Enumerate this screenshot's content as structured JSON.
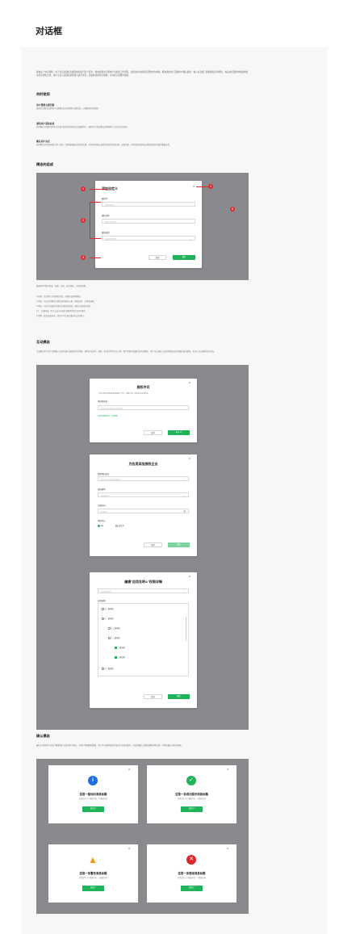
{
  "page": {
    "title": "对话框"
  },
  "intro": "模态是一种对话框，用于显示关键信息或请求您执行某个任务。模态会通过打断用户当前的工作流程，迫使用户先处理对话框中的内容。模态通常用于需要用户确认操作、输入信息或了解重要提示的场景，在完成对话框内的操作或关闭对话框之前，用户无法与页面的其他部分进行交互。因此在使用时应谨慎，只在真正需要时使用。",
  "when": {
    "heading": "何时使用",
    "items": [
      {
        "title": "用户需要立即回复",
        "desc": "使用对话框来请求用户立即做出决定或提供关键信息，以便继续当前流程。"
      },
      {
        "title": "通知用户紧急信息",
        "desc": "使用模式对话框可将有关系统当前状态的紧急信息通知用户，通常用于系统错误或需要用户立刻关注的情况。"
      },
      {
        "title": "确认用户决定",
        "desc": "使用模式对话框来确认用户决定。需要描述确认操作的后果，并说明可能无法撤消的操作及其后果。如果需要，可提供取消选项以避免误操作导致的数据丢失。"
      }
    ]
  },
  "anatomy": {
    "heading": "模态的组成",
    "modal": {
      "title": "添加自定义",
      "fields": [
        {
          "label": "属性ID",
          "placeholder": "请输入属性ID"
        },
        {
          "label": "属性名称",
          "placeholder": "请输入属性名称"
        },
        {
          "label": "属性类型",
          "placeholder": "请选择属性类型"
        }
      ],
      "cancel": "取消",
      "ok": "确定"
    },
    "markers": [
      "1",
      "2",
      "3",
      "4",
      "5"
    ],
    "caption": "模态框有5部分组成：标题、内容、操作按钮、关闭和遮罩。",
    "list": [
      "1.标题：告诉用户对话框的目的，标题应该清晰简短。",
      "2.内容：包含对话框的主要信息和操作元素，例如表单、文本或选项。",
      "3.按钮：包括主要操作按钮和次要操作按钮，通常主按钮在右侧。",
      "4.x：关闭按钮，用户点击可关闭对话框而不执行任何操作。",
      "5.遮罩：遮盖页面内容，使用户的注意力集中在对话框上。"
    ]
  },
  "interactive": {
    "heading": "互动模态",
    "desc": "互动模式用于用户需要输入信息或进行选择操作的场景，通常包含表单、列表、树形控件等交互元素，用户需要完成操作后才能继续。用户可以通过点击取消按钮或关闭图标退出模态，也可以点击确定提交内容。",
    "license": {
      "title": "授权许可",
      "desc": "一体企业邮件服务需要获取用户许可。请输入客户授权码后完成授权。",
      "label": "授权验证码",
      "placeholder": "请输入客户授权码以验证授权",
      "link": "没有授权验证码？点此重发",
      "cancel": "取消",
      "ok": "Sign up"
    },
    "enterprise": {
      "title": "为应用添加授权企业",
      "f1_label": "搜索授权企业",
      "f1_ph": "输入企业名称搜索授权企业",
      "f2_label": "选择版本",
      "f2_ph": "请选择版本",
      "f3_label": "开始时间",
      "f3_ph": "选择时间",
      "radio_label": "授权时长",
      "radio1": "1年",
      "radio2": "自定义",
      "cancel": "取消",
      "ok": "确定"
    },
    "perm": {
      "title": "编辑\"应用名称A\"权限详情",
      "search_ph": "搜索权限名称",
      "tree_label": "应用权限",
      "rows": [
        "一级权限",
        "一级权限",
        "二级权限",
        "二级权限",
        "三级权限",
        "三级权限",
        "一级权限"
      ],
      "cancel": "取消",
      "ok": "确定"
    }
  },
  "confirm": {
    "heading": "确认模态",
    "desc": "确认对话框用于在执行重要操作之前向用户确认。当用户需要删除数据、执行不可撤销的操作或进行关键决策时，应使用确认对话框清晰说明后果，并提供确认和取消选项。",
    "cards": [
      {
        "title": "这是一般询问消息标题",
        "sub": "这里是关于小描述内容，小描述内容",
        "btn": "知道了",
        "icon": "info-icon",
        "color": "#1e6fe0",
        "glyph": "i"
      },
      {
        "title": "这是一条成功提示消息标题",
        "sub": "这里是关于小描述内容，小描述内容",
        "btn": "知道了",
        "icon": "success-icon",
        "color": "#20b35a",
        "glyph": "✓"
      },
      {
        "title": "这是一条警告消息标题",
        "sub": "这里是关于小描述内容，小描述内容",
        "btn": "知道了",
        "icon": "warning-icon",
        "color": "#f29a17",
        "glyph": "!"
      },
      {
        "title": "这是一条错误消息标题",
        "sub": "这里是关于小描述内容，小描述内容",
        "btn": "知道了",
        "icon": "error-icon",
        "color": "#e0282c",
        "glyph": "✕"
      }
    ]
  }
}
